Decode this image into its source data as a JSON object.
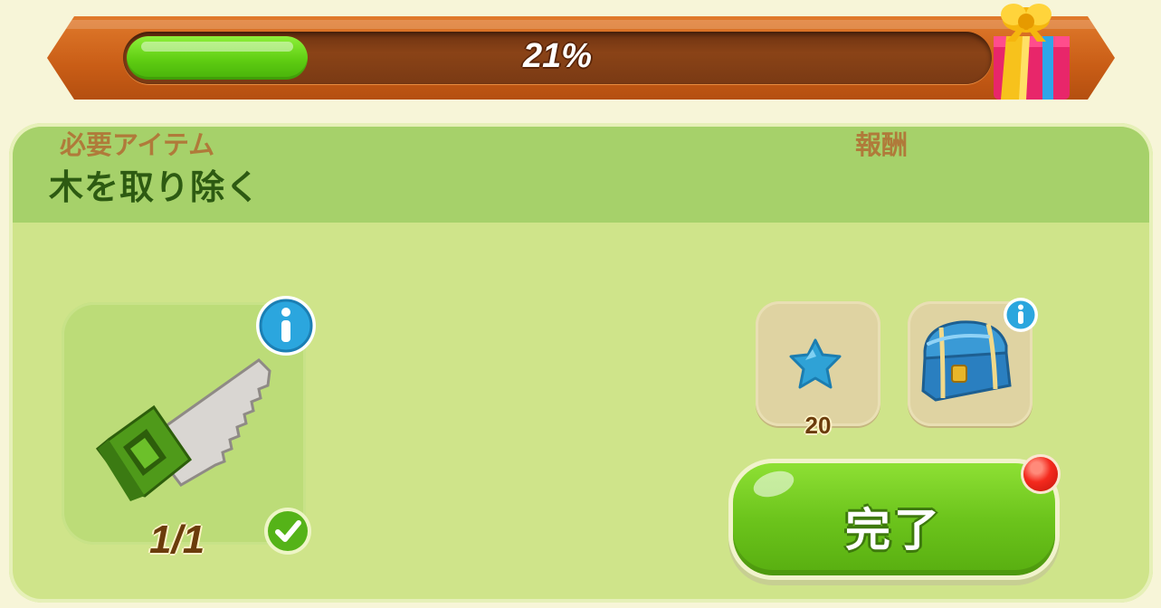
{
  "progress": {
    "percent_label": "21%",
    "value": 0.21,
    "reward_icon": "gift-icon"
  },
  "task": {
    "title": "木を取り除く",
    "required_label": "必要アイテム",
    "reward_label": "報酬",
    "required_item": {
      "icon": "saw-icon",
      "count_label": "1/1",
      "status_icon": "check-icon"
    },
    "rewards": [
      {
        "icon": "blue-star-icon",
        "amount": "20"
      },
      {
        "icon": "treasure-chest-icon"
      }
    ],
    "complete_button_label": "完了"
  },
  "colors": {
    "panel": "#cfe48a",
    "header": "#a6d16a",
    "progress_fill": "#5fcd12",
    "progress_frame": "#c95d16",
    "title_text": "#2d5a12",
    "label_text": "#b07a3a"
  }
}
